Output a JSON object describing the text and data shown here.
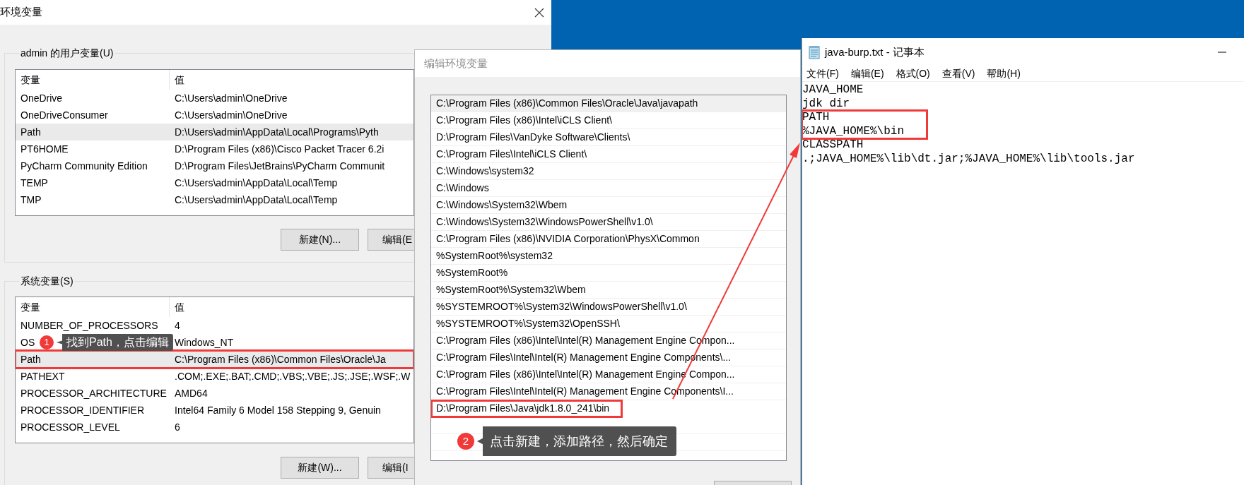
{
  "env_window": {
    "title": "环境变量",
    "user_vars": {
      "label": "admin 的用户变量(U)",
      "columns": [
        "变量",
        "值"
      ],
      "rows": [
        {
          "name": "OneDrive",
          "value": "C:\\Users\\admin\\OneDrive",
          "selected": false,
          "outlined": false
        },
        {
          "name": "OneDriveConsumer",
          "value": "C:\\Users\\admin\\OneDrive",
          "selected": false,
          "outlined": false
        },
        {
          "name": "Path",
          "value": "D:\\Users\\admin\\AppData\\Local\\Programs\\Pyth",
          "selected": true,
          "outlined": false
        },
        {
          "name": "PT6HOME",
          "value": "D:\\Program Files (x86)\\Cisco Packet Tracer 6.2i",
          "selected": false,
          "outlined": false
        },
        {
          "name": "PyCharm Community Edition",
          "value": "D:\\Program Files\\JetBrains\\PyCharm Communit",
          "selected": false,
          "outlined": false
        },
        {
          "name": "TEMP",
          "value": "C:\\Users\\admin\\AppData\\Local\\Temp",
          "selected": false,
          "outlined": false
        },
        {
          "name": "TMP",
          "value": "C:\\Users\\admin\\AppData\\Local\\Temp",
          "selected": false,
          "outlined": false
        }
      ],
      "buttons": [
        "新建(N)...",
        "编辑(E"
      ]
    },
    "system_vars": {
      "label": "系统变量(S)",
      "columns": [
        "变量",
        "值"
      ],
      "rows": [
        {
          "name": "NUMBER_OF_PROCESSORS",
          "value": "4",
          "selected": false,
          "outlined": false
        },
        {
          "name": "OS",
          "value": "Windows_NT",
          "selected": false,
          "outlined": false
        },
        {
          "name": "Path",
          "value": "C:\\Program Files (x86)\\Common Files\\Oracle\\Ja",
          "selected": true,
          "outlined": true
        },
        {
          "name": "PATHEXT",
          "value": ".COM;.EXE;.BAT;.CMD;.VBS;.VBE;.JS;.JSE;.WSF;.W",
          "selected": false,
          "outlined": false
        },
        {
          "name": "PROCESSOR_ARCHITECTURE",
          "value": "AMD64",
          "selected": false,
          "outlined": false
        },
        {
          "name": "PROCESSOR_IDENTIFIER",
          "value": "Intel64 Family 6 Model 158 Stepping 9, Genuin",
          "selected": false,
          "outlined": false
        },
        {
          "name": "PROCESSOR_LEVEL",
          "value": "6",
          "selected": false,
          "outlined": false
        }
      ],
      "buttons": [
        "新建(W)...",
        "编辑(I"
      ]
    }
  },
  "edit_window": {
    "title": "编辑环境变量",
    "items": [
      {
        "text": "C:\\Program Files (x86)\\Common Files\\Oracle\\Java\\javapath",
        "selected": true,
        "outlined": false
      },
      {
        "text": "C:\\Program Files (x86)\\Intel\\iCLS Client\\",
        "selected": false,
        "outlined": false
      },
      {
        "text": "D:\\Program Files\\VanDyke Software\\Clients\\",
        "selected": false,
        "outlined": false
      },
      {
        "text": "C:\\Program Files\\Intel\\iCLS Client\\",
        "selected": false,
        "outlined": false
      },
      {
        "text": "C:\\Windows\\system32",
        "selected": false,
        "outlined": false
      },
      {
        "text": "C:\\Windows",
        "selected": false,
        "outlined": false
      },
      {
        "text": "C:\\Windows\\System32\\Wbem",
        "selected": false,
        "outlined": false
      },
      {
        "text": "C:\\Windows\\System32\\WindowsPowerShell\\v1.0\\",
        "selected": false,
        "outlined": false
      },
      {
        "text": "C:\\Program Files (x86)\\NVIDIA Corporation\\PhysX\\Common",
        "selected": false,
        "outlined": false
      },
      {
        "text": "%SystemRoot%\\system32",
        "selected": false,
        "outlined": false
      },
      {
        "text": "%SystemRoot%",
        "selected": false,
        "outlined": false
      },
      {
        "text": "%SystemRoot%\\System32\\Wbem",
        "selected": false,
        "outlined": false
      },
      {
        "text": "%SYSTEMROOT%\\System32\\WindowsPowerShell\\v1.0\\",
        "selected": false,
        "outlined": false
      },
      {
        "text": "%SYSTEMROOT%\\System32\\OpenSSH\\",
        "selected": false,
        "outlined": false
      },
      {
        "text": "C:\\Program Files (x86)\\Intel\\Intel(R) Management Engine Compon...",
        "selected": false,
        "outlined": false
      },
      {
        "text": "C:\\Program Files\\Intel\\Intel(R) Management Engine Components\\...",
        "selected": false,
        "outlined": false
      },
      {
        "text": "C:\\Program Files (x86)\\Intel\\Intel(R) Management Engine Compon...",
        "selected": false,
        "outlined": false
      },
      {
        "text": "C:\\Program Files\\Intel\\Intel(R) Management Engine Components\\I...",
        "selected": false,
        "outlined": false
      },
      {
        "text": "D:\\Program Files\\Java\\jdk1.8.0_241\\bin",
        "selected": false,
        "outlined": true
      }
    ]
  },
  "notepad": {
    "title": "java-burp.txt - 记事本",
    "menu": [
      "文件(F)",
      "编辑(E)",
      "格式(O)",
      "查看(V)",
      "帮助(H)"
    ],
    "blocks": [
      {
        "lines": [
          "JAVA_HOME",
          "jdk dir"
        ],
        "outlined": false
      },
      {
        "lines": [
          "PATH",
          "%JAVA_HOME%\\bin"
        ],
        "outlined": true
      },
      {
        "lines": [
          "CLASSPATH",
          ".;JAVA_HOME%\\lib\\dt.jar;%JAVA_HOME%\\lib\\tools.jar"
        ],
        "outlined": false
      }
    ]
  },
  "callouts": [
    {
      "number": "1",
      "text": "找到Path，点击编辑"
    },
    {
      "number": "2",
      "text": "点击新建，添加路径，然后确定"
    }
  ]
}
